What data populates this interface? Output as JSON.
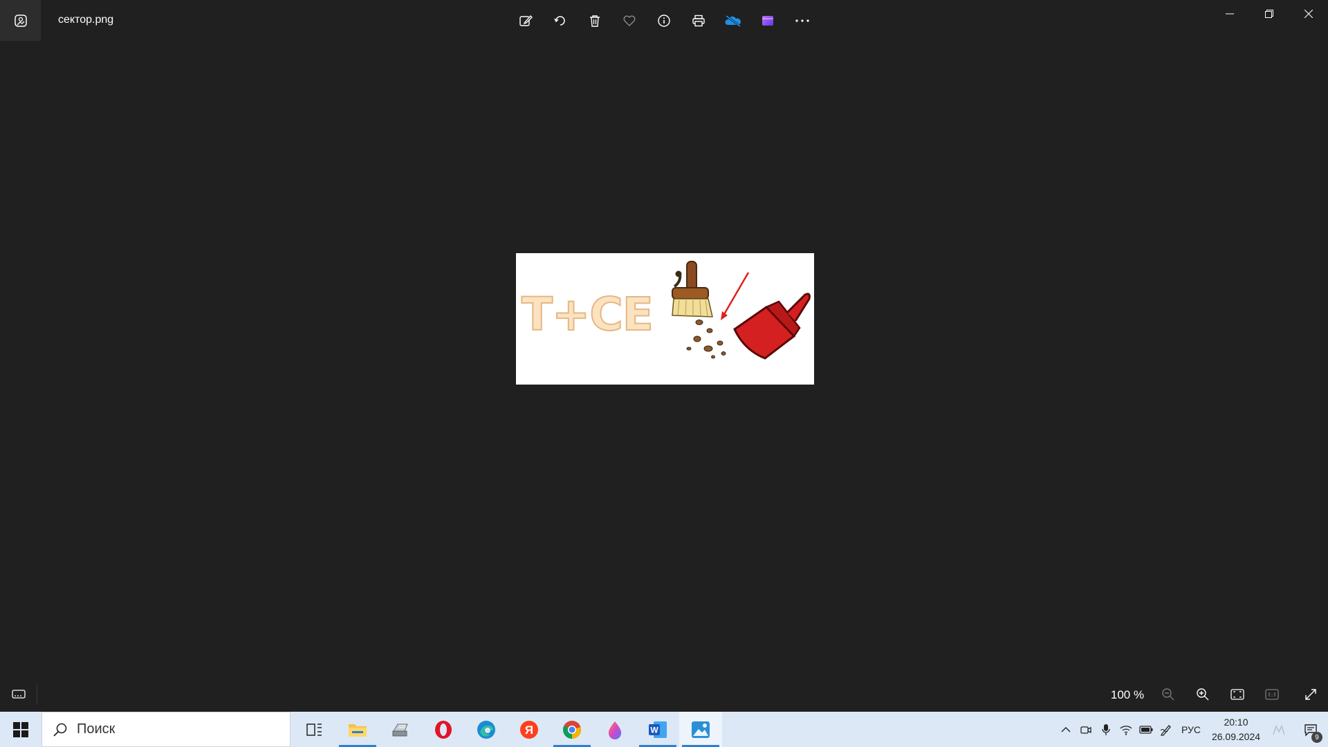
{
  "window": {
    "file_name": "сектор.png",
    "toolbar": [
      {
        "name": "edit-image-icon",
        "label": "Edit image"
      },
      {
        "name": "rotate-icon",
        "label": "Rotate"
      },
      {
        "name": "delete-icon",
        "label": "Delete"
      },
      {
        "name": "favorite-icon",
        "label": "Add to favorites"
      },
      {
        "name": "info-icon",
        "label": "File information"
      },
      {
        "name": "print-icon",
        "label": "Print"
      },
      {
        "name": "onedrive-icon",
        "label": "OneDrive"
      },
      {
        "name": "clipchamp-icon",
        "label": "Clipchamp"
      },
      {
        "name": "more-icon",
        "label": "See more"
      }
    ]
  },
  "image": {
    "text": "Т+СЕ"
  },
  "bottom_bar": {
    "zoom": "100 %"
  },
  "taskbar": {
    "search_placeholder": "Поиск",
    "language": "РУС",
    "time": "20:10",
    "date": "26.09.2024",
    "notification_count": "9",
    "apps": [
      {
        "name": "task-view-icon",
        "running": false,
        "active": false
      },
      {
        "name": "file-explorer-icon",
        "running": true,
        "active": false
      },
      {
        "name": "scanner-icon",
        "running": false,
        "active": false
      },
      {
        "name": "opera-icon",
        "running": false,
        "active": false
      },
      {
        "name": "edge-icon",
        "running": false,
        "active": false
      },
      {
        "name": "yandex-icon",
        "running": false,
        "active": false
      },
      {
        "name": "chrome-icon",
        "running": true,
        "active": false
      },
      {
        "name": "drop-app-icon",
        "running": false,
        "active": false
      },
      {
        "name": "word-icon",
        "running": true,
        "active": false
      },
      {
        "name": "photos-icon",
        "running": true,
        "active": true
      }
    ]
  },
  "colors": {
    "background": "#202020",
    "taskbar": "#dce8f5",
    "accent": "#2b7fd3",
    "dustpan_red": "#d42020"
  }
}
